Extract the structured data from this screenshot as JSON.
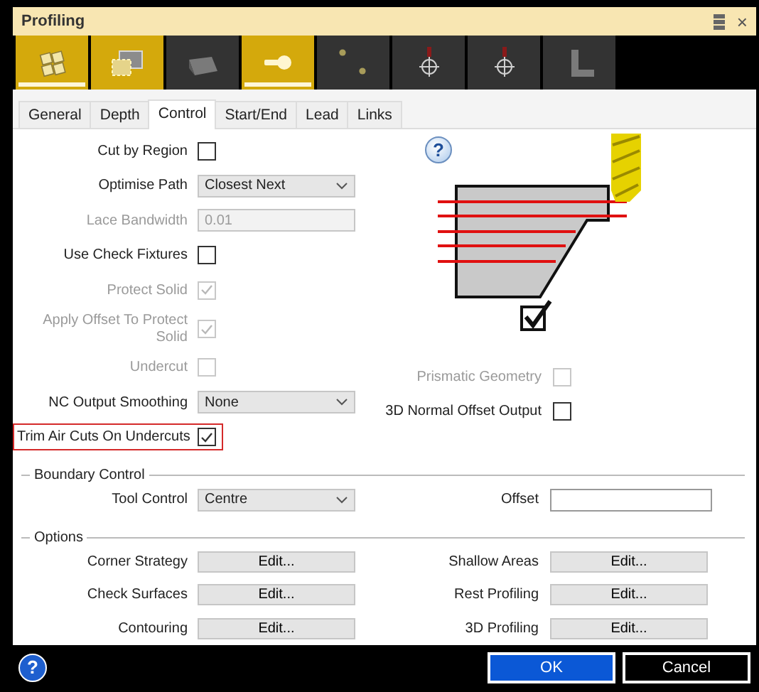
{
  "window": {
    "title": "Profiling",
    "close": "×"
  },
  "toolbar": [
    {
      "kind": "region",
      "on": true,
      "selected": true
    },
    {
      "kind": "boundary",
      "on": true,
      "selected": false
    },
    {
      "kind": "surface",
      "on": false,
      "selected": false
    },
    {
      "kind": "tool",
      "on": true,
      "selected": true
    },
    {
      "kind": "points",
      "on": false,
      "selected": false
    },
    {
      "kind": "start-point",
      "on": false,
      "selected": false
    },
    {
      "kind": "end-point",
      "on": false,
      "selected": false
    },
    {
      "kind": "corner",
      "on": false,
      "selected": false
    }
  ],
  "tabs": [
    {
      "label": "General",
      "selected": false
    },
    {
      "label": "Depth",
      "selected": false
    },
    {
      "label": "Control",
      "selected": true
    },
    {
      "label": "Start/End",
      "selected": false
    },
    {
      "label": "Lead",
      "selected": false
    },
    {
      "label": "Links",
      "selected": false
    }
  ],
  "diagram": {
    "help": "?",
    "checked": true
  },
  "left_fields": [
    {
      "kind": "checkbox",
      "label": "Cut by Region",
      "checked": false,
      "disabled": false,
      "highlighted": false
    },
    {
      "kind": "dropdown",
      "label": "Optimise Path",
      "value": "Closest Next",
      "disabled": false,
      "highlighted": false
    },
    {
      "kind": "input",
      "label": "Lace Bandwidth",
      "value": "0.01",
      "disabled": true,
      "highlighted": false
    },
    {
      "kind": "checkbox",
      "label": "Use Check Fixtures",
      "checked": false,
      "disabled": false,
      "highlighted": false
    },
    {
      "kind": "checkbox",
      "label": "Protect Solid",
      "checked": true,
      "disabled": true,
      "highlighted": false
    },
    {
      "kind": "checkbox",
      "label": "Apply Offset To Protect Solid",
      "checked": true,
      "disabled": true,
      "highlighted": false
    },
    {
      "kind": "checkbox",
      "label": "Undercut",
      "checked": false,
      "disabled": true,
      "highlighted": false
    },
    {
      "kind": "dropdown",
      "label": "NC Output Smoothing",
      "value": "None",
      "disabled": false,
      "highlighted": false
    },
    {
      "kind": "checkbox",
      "label": "Trim Air Cuts On Undercuts",
      "checked": true,
      "disabled": false,
      "highlighted": true
    }
  ],
  "right_fields": [
    {
      "kind": "checkbox",
      "label": "Prismatic Geometry",
      "checked": false,
      "disabled": true
    },
    {
      "kind": "checkbox",
      "label": "3D Normal Offset Output",
      "checked": false,
      "disabled": false
    }
  ],
  "boundary_control": {
    "title": "Boundary Control",
    "tool_control": {
      "label": "Tool Control",
      "value": "Centre"
    },
    "offset": {
      "label": "Offset"
    }
  },
  "options": {
    "title": "Options",
    "items": [
      {
        "label": "Corner Strategy",
        "button": "Edit..."
      },
      {
        "label": "Shallow Areas",
        "button": "Edit..."
      },
      {
        "label": "Check Surfaces",
        "button": "Edit..."
      },
      {
        "label": "Rest Profiling",
        "button": "Edit..."
      },
      {
        "label": "Contouring",
        "button": "Edit..."
      },
      {
        "label": "3D Profiling",
        "button": "Edit..."
      }
    ]
  },
  "footer": {
    "help": "?",
    "ok": "OK",
    "cancel": "Cancel"
  }
}
